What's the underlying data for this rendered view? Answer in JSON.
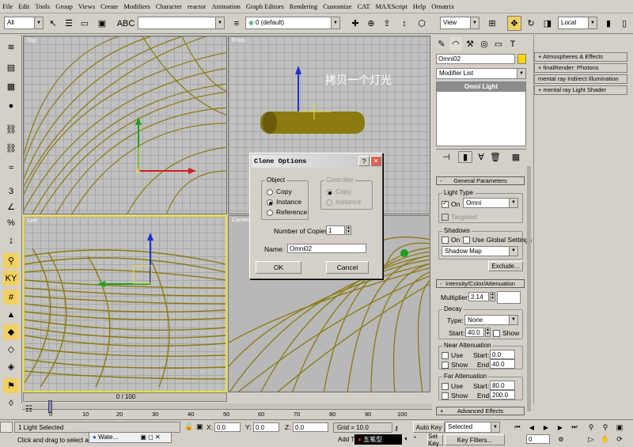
{
  "menu": [
    "File",
    "Edit",
    "Tools",
    "Group",
    "Views",
    "Create",
    "Modifiers",
    "Character",
    "reactor",
    "Animation",
    "Graph Editors",
    "Rendering",
    "Customize",
    "CAT",
    "MAXScript",
    "Help",
    "Ornatrix"
  ],
  "toolbar": {
    "filter_value": "All",
    "layer_value": "0 (default)",
    "view_value": "View",
    "coord_value": "Local"
  },
  "viewports": {
    "top_label": "Top",
    "front_label": "Front",
    "left_label": "Left",
    "camera_label": "Camera",
    "annotation": "拷贝一个灯光"
  },
  "dialog": {
    "title": "Clone Options",
    "help_btn": "?",
    "close_btn": "✕",
    "object_group": "Object",
    "controller_group": "Controller",
    "opt_copy": "Copy",
    "opt_instance": "Instance",
    "opt_reference": "Reference",
    "ctrl_copy": "Copy",
    "ctrl_instance": "Instance",
    "copies_label": "Number of Copies:",
    "copies_value": "1",
    "name_label": "Name:",
    "name_value": "Omni02",
    "ok": "OK",
    "cancel": "Cancel"
  },
  "cmdpanel": {
    "object_name": "Omni02",
    "modifier_list": "Modifier List",
    "stack_item": "Omni Light",
    "general_params": "General Parameters",
    "light_type": "Light Type",
    "on_label": "On",
    "light_type_value": "Omni",
    "targeted": "Targeted",
    "shadows": "Shadows",
    "shadows_on": "On",
    "use_global": "Use Global Settings",
    "shadow_type": "Shadow Map",
    "exclude": "Exclude...",
    "intensity_section": "Intensity/Color/Attenuation",
    "multiplier_label": "Multiplier:",
    "multiplier_value": "2.14",
    "decay": "Decay",
    "type_label": "Type:",
    "type_value": "None",
    "start_label": "Start:",
    "decay_start": "40.0",
    "show": "Show",
    "near_atten": "Near Attenuation",
    "use": "Use",
    "near_start": "0.0",
    "near_end": "40.0",
    "end_label": "End:",
    "far_atten": "Far Attenuation",
    "far_start": "80.0",
    "far_end": "200.0",
    "advanced": "Advanced Effects"
  },
  "rollouts": [
    "Atmospheres & Effects",
    "finalRender: Photons",
    "mental ray Indirect Illumination",
    "mental ray Light Shader"
  ],
  "timeline": {
    "frame": "0 / 100",
    "ticks": [
      "0",
      "10",
      "20",
      "30",
      "40",
      "50",
      "60",
      "70",
      "80",
      "90",
      "100"
    ]
  },
  "status": {
    "selected": "1 Light Selected",
    "prompt": "Click and drag to select an",
    "x_label": "X:",
    "x_value": "0.0",
    "y_label": "Y:",
    "y_value": "0.0",
    "z_label": "Z:",
    "z_value": "0.0",
    "grid": "Grid = 10.0",
    "add_time": "Add T",
    "auto_key": "Auto Key",
    "set_key": "Set Key",
    "selected_dd": "Selected",
    "key_filters": "Key Filters...",
    "frame_value": "0",
    "taskbar_item": "Wate...",
    "ime_text": "五笔型"
  }
}
